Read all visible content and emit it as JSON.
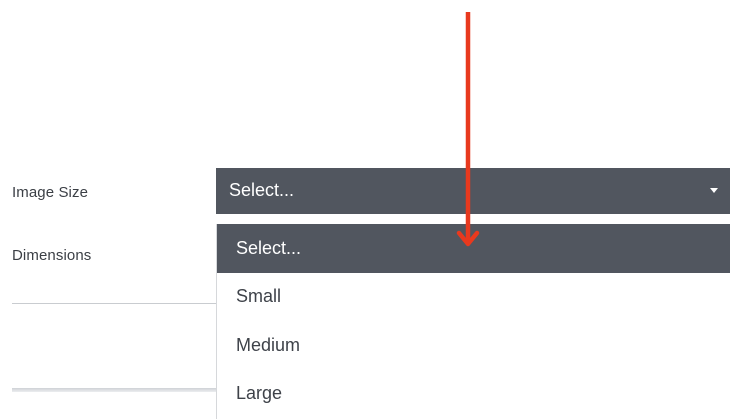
{
  "form": {
    "image_size_label": "Image Size",
    "dimensions_label": "Dimensions"
  },
  "select": {
    "current_value": "Select...",
    "caret_icon": "caret-down-icon",
    "background_color": "#51565f",
    "options": [
      {
        "label": "Select...",
        "highlighted": true
      },
      {
        "label": "Small",
        "highlighted": false
      },
      {
        "label": "Medium",
        "highlighted": false
      },
      {
        "label": "Large",
        "highlighted": false
      }
    ]
  },
  "annotation": {
    "arrow_icon": "arrow-down-icon",
    "color": "#e8391e"
  }
}
